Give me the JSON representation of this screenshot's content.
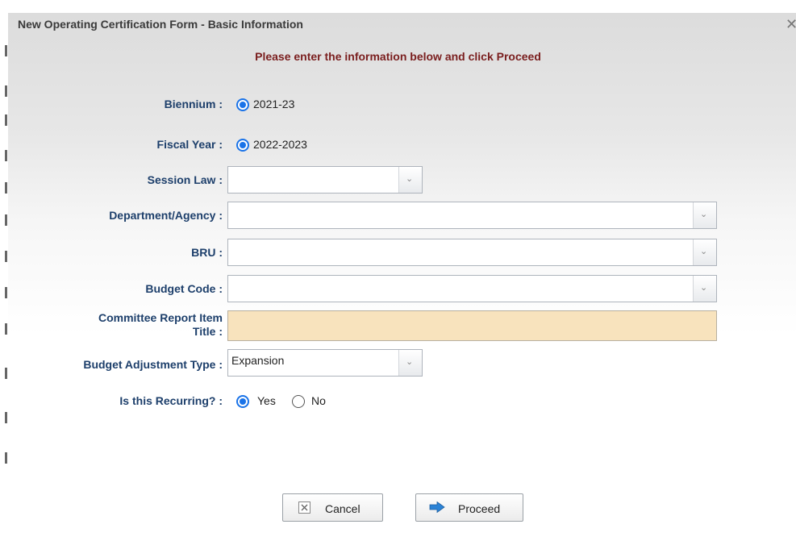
{
  "dialog": {
    "title": "New Operating Certification Form - Basic Information",
    "close_glyph": "✕",
    "instruction": "Please enter the information below and click Proceed"
  },
  "fields": {
    "biennium": {
      "label": "Biennium :",
      "option": "2021-23",
      "selected": true
    },
    "fiscal_year": {
      "label": "Fiscal Year :",
      "option": "2022-2023",
      "selected": true
    },
    "session_law": {
      "label": "Session Law :",
      "value": ""
    },
    "department": {
      "label": "Department/Agency :",
      "value": ""
    },
    "bru": {
      "label": "BRU :",
      "value": ""
    },
    "budget_code": {
      "label": "Budget Code :",
      "value": ""
    },
    "committee_title": {
      "label_line1": "Committee Report Item",
      "label_line2": "Title :",
      "value": ""
    },
    "adjustment_type": {
      "label": "Budget Adjustment Type :",
      "value": "Expansion"
    },
    "recurring": {
      "label": "Is this Recurring? :",
      "options": [
        "Yes",
        "No"
      ],
      "selected": "Yes"
    }
  },
  "buttons": {
    "cancel": "Cancel",
    "proceed": "Proceed"
  },
  "icons": {
    "dropdown": "chevron-down-icon",
    "cancel": "x-box-icon",
    "proceed": "arrow-right-icon"
  },
  "colors": {
    "label": "#1d3f6b",
    "instruction": "#7a1e1e",
    "radio": "#1a73e8",
    "textarea_bg": "#f8e3bd",
    "arrow": "#2b83d6"
  }
}
